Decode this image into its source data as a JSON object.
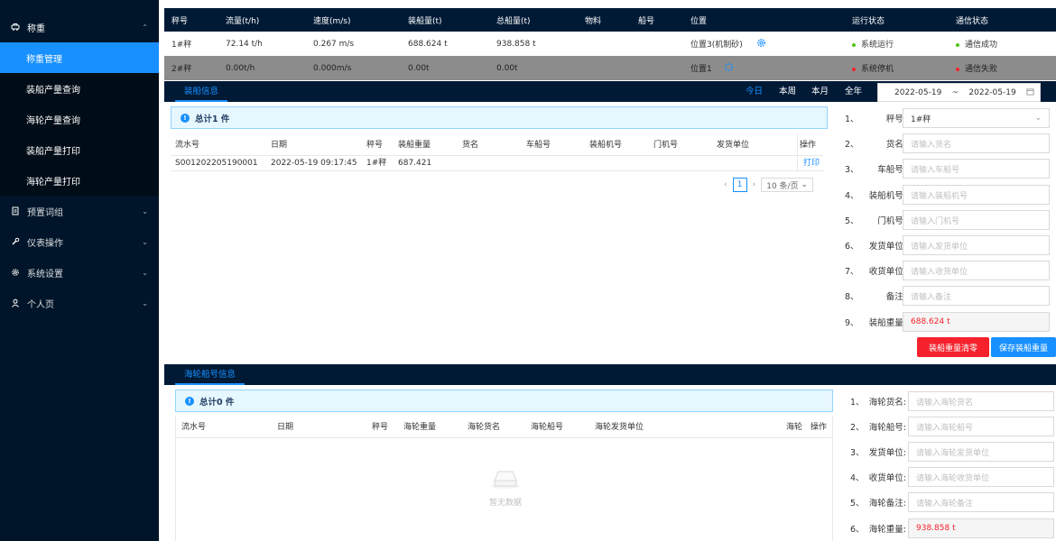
{
  "sidebar": {
    "groups": [
      {
        "label": "称重",
        "icon": "car-icon",
        "chev": "⌃"
      },
      {
        "label": "预置词组",
        "icon": "file-icon",
        "chev": "⌄"
      },
      {
        "label": "仪表操作",
        "icon": "wrench-icon",
        "chev": "⌄"
      },
      {
        "label": "系统设置",
        "icon": "gear-icon",
        "chev": "⌄"
      },
      {
        "label": "个人页",
        "icon": "user-icon",
        "chev": "⌄"
      }
    ],
    "sub_items": [
      "称重管理",
      "装船产量查询",
      "海轮产量查询",
      "装船产量打印",
      "海轮产量打印"
    ]
  },
  "top_table": {
    "headers": [
      "秤号",
      "流量(t/h)",
      "速度(m/s)",
      "装船量(t)",
      "总船量(t)",
      "物料",
      "船号",
      "位置",
      "运行状态",
      "通信状态"
    ],
    "rows": [
      {
        "scale": "1#秤",
        "flow": "72.14 t/h",
        "speed": "0.267 m/s",
        "load": "688.624 t",
        "total": "938.858 t",
        "material": "",
        "ship": "",
        "position": "位置3(机制砂)",
        "run": "系统运行",
        "comm": "通信成功",
        "run_color": "#52c41a",
        "comm_color": "#52c41a"
      },
      {
        "scale": "2#秤",
        "flow": "0.00t/h",
        "speed": "0.000m/s",
        "load": "0.00t",
        "total": "0.00t",
        "material": "",
        "ship": "",
        "position": "位置1",
        "run": "系统停机",
        "comm": "通信失败",
        "run_color": "#f5222d",
        "comm_color": "#f5222d"
      }
    ]
  },
  "loading": {
    "tab": "装船信息",
    "filters": [
      "今日",
      "本周",
      "本月",
      "全年"
    ],
    "date_start": "2022-05-19",
    "date_sep": "~",
    "date_end": "2022-05-19",
    "total": "总计1 件",
    "headers": [
      "流水号",
      "日期",
      "秤号",
      "装船重量",
      "货名",
      "车船号",
      "装船机号",
      "门机号",
      "发货单位",
      "操作"
    ],
    "rows": [
      {
        "serial": "S001202205190001",
        "date": "2022-05-19 09:17:45",
        "scale": "1#秤",
        "weight": "687.421",
        "goods": "",
        "car": "",
        "loader": "",
        "gate": "",
        "sender": "",
        "op": "打印"
      }
    ],
    "page": "1",
    "page_size": "10 条/页",
    "form": [
      {
        "num": "1、",
        "label": "秤号:",
        "value": "1#秤",
        "placeholder": ""
      },
      {
        "num": "2、",
        "label": "货名:",
        "value": "",
        "placeholder": "请输入货名"
      },
      {
        "num": "3、",
        "label": "车船号:",
        "value": "",
        "placeholder": "请输入车船号"
      },
      {
        "num": "4、",
        "label": "装船机号:",
        "value": "",
        "placeholder": "请输入装船机号"
      },
      {
        "num": "5、",
        "label": "门机号:",
        "value": "",
        "placeholder": "请输入门机号"
      },
      {
        "num": "6、",
        "label": "发货单位:",
        "value": "",
        "placeholder": "请输入发货单位"
      },
      {
        "num": "7、",
        "label": "收货单位:",
        "value": "",
        "placeholder": "请输入收货单位"
      },
      {
        "num": "8、",
        "label": "备注:",
        "value": "",
        "placeholder": "请输入备注"
      },
      {
        "num": "9、",
        "label": "装船重量:",
        "value": "688.624 t",
        "placeholder": ""
      }
    ],
    "btn_clear": "装船重量清零",
    "btn_save": "保存装船重量"
  },
  "ship": {
    "tab": "海轮船号信息",
    "total": "总计0 件",
    "headers": [
      "流水号",
      "日期",
      "秤号",
      "海轮重量",
      "海轮货名",
      "海轮船号",
      "海轮发货单位",
      "海轮",
      "操作"
    ],
    "empty": "暂无数据",
    "form": [
      {
        "num": "1、",
        "label": "海轮货名:",
        "value": "",
        "placeholder": "请输入海轮货名"
      },
      {
        "num": "2、",
        "label": "海轮船号:",
        "value": "",
        "placeholder": "请输入海轮船号"
      },
      {
        "num": "3、",
        "label": "发货单位:",
        "value": "",
        "placeholder": "请输入海轮发货单位"
      },
      {
        "num": "4、",
        "label": "收货单位:",
        "value": "",
        "placeholder": "请输入海轮收货单位"
      },
      {
        "num": "5、",
        "label": "海轮备注:",
        "value": "",
        "placeholder": "请输入海轮备注"
      },
      {
        "num": "6、",
        "label": "海轮重量:",
        "value": "938.858 t",
        "placeholder": ""
      }
    ]
  },
  "colors": {
    "sidebar_bg": "#001529",
    "accent": "#1890ff",
    "danger": "#f5222d",
    "success": "#52c41a",
    "header_bg": "#001a36"
  }
}
